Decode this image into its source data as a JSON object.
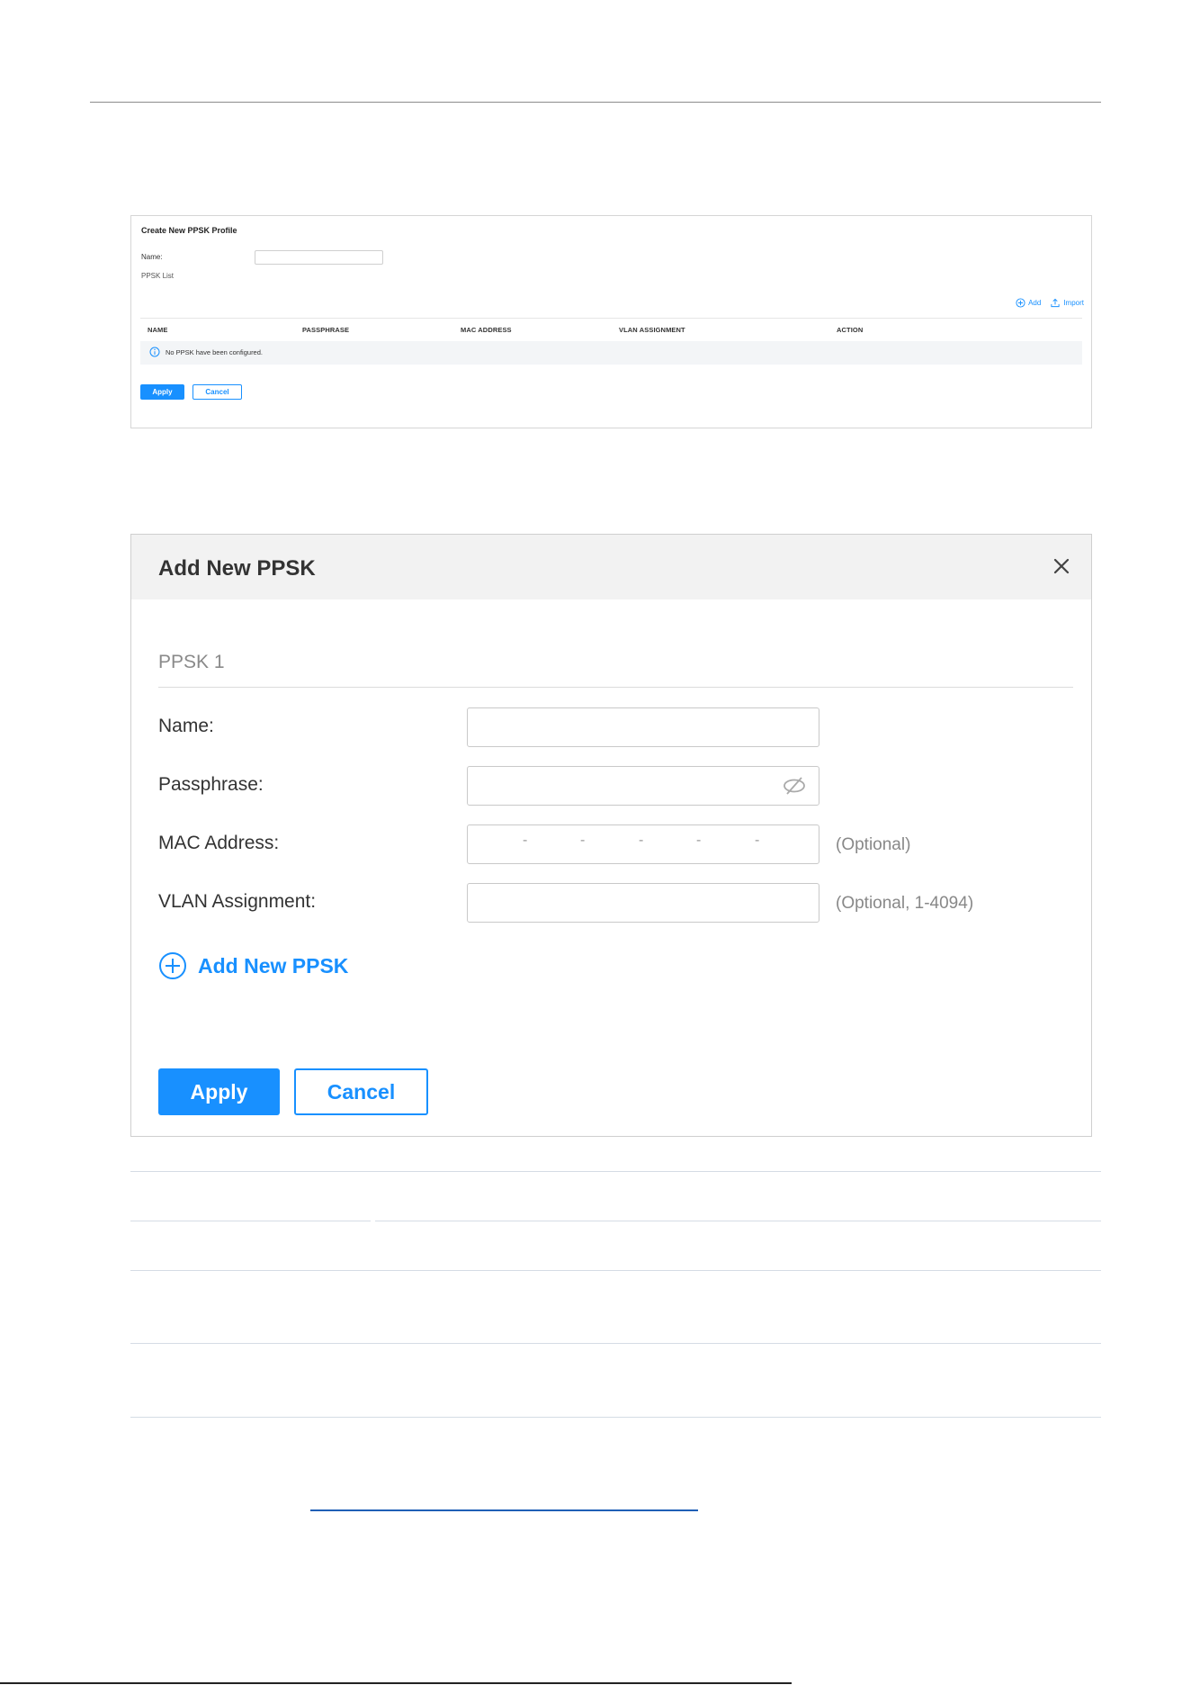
{
  "profile": {
    "title": "Create New PPSK Profile",
    "name_label": "Name:",
    "name_value": "",
    "list_label": "PPSK List",
    "toolbar": {
      "add": "Add",
      "import": "Import"
    },
    "columns": [
      "NAME",
      "PASSPHRASE",
      "MAC ADDRESS",
      "VLAN ASSIGNMENT",
      "ACTION"
    ],
    "empty_message": "No PPSK have been configured.",
    "apply": "Apply",
    "cancel": "Cancel"
  },
  "dialog": {
    "title": "Add New PPSK",
    "section": "PPSK 1",
    "name_label": "Name:",
    "passphrase_label": "Passphrase:",
    "mac_label": "MAC Address:",
    "mac_hint": "(Optional)",
    "mac_separator": "-",
    "vlan_label": "VLAN Assignment:",
    "vlan_hint": "(Optional, 1-4094)",
    "add_link": "Add New PPSK",
    "apply": "Apply",
    "cancel": "Cancel"
  },
  "colors": {
    "accent": "#1890ff",
    "header_bg": "#f2f2f2",
    "empty_row_bg": "#f3f5f7"
  }
}
